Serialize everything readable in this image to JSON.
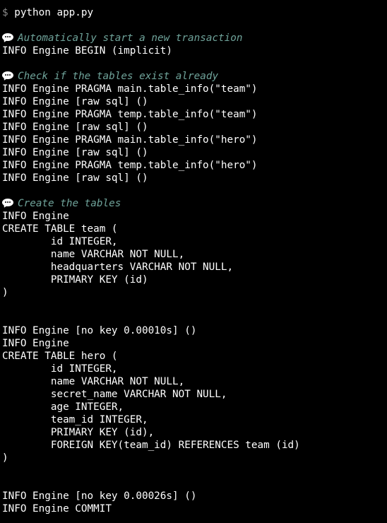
{
  "prompt": {
    "symbol": "$",
    "command": "python app.py"
  },
  "comments": {
    "begin": "Automatically start a new transaction",
    "check": "Check if the tables exist already",
    "create": "Create the tables"
  },
  "lines": {
    "begin_info": "INFO Engine BEGIN (implicit)",
    "pragma_1": "INFO Engine PRAGMA main.table_info(\"team\")",
    "raw_1": "INFO Engine [raw sql] ()",
    "pragma_2": "INFO Engine PRAGMA temp.table_info(\"team\")",
    "raw_2": "INFO Engine [raw sql] ()",
    "pragma_3": "INFO Engine PRAGMA main.table_info(\"hero\")",
    "raw_3": "INFO Engine [raw sql] ()",
    "pragma_4": "INFO Engine PRAGMA temp.table_info(\"hero\")",
    "raw_4": "INFO Engine [raw sql] ()",
    "create_team_info": "INFO Engine",
    "create_team": "CREATE TABLE team (",
    "team_id": "        id INTEGER,",
    "team_name": "        name VARCHAR NOT NULL,",
    "team_hq": "        headquarters VARCHAR NOT NULL,",
    "team_pk": "        PRIMARY KEY (id)",
    "team_close": ")",
    "no_key_1": "INFO Engine [no key 0.00010s] ()",
    "create_hero_info": "INFO Engine",
    "create_hero": "CREATE TABLE hero (",
    "hero_id": "        id INTEGER,",
    "hero_name": "        name VARCHAR NOT NULL,",
    "hero_secret": "        secret_name VARCHAR NOT NULL,",
    "hero_age": "        age INTEGER,",
    "hero_team_id": "        team_id INTEGER,",
    "hero_pk": "        PRIMARY KEY (id),",
    "hero_fk": "        FOREIGN KEY(team_id) REFERENCES team (id)",
    "hero_close": ")",
    "no_key_2": "INFO Engine [no key 0.00026s] ()",
    "commit": "INFO Engine COMMIT"
  },
  "colors": {
    "background": "#000000",
    "text": "#ffffff",
    "comment": "#6fa39a",
    "prompt_symbol": "#8a8a8a"
  },
  "icons": {
    "comment_icon": "speech-bubble-icon"
  }
}
